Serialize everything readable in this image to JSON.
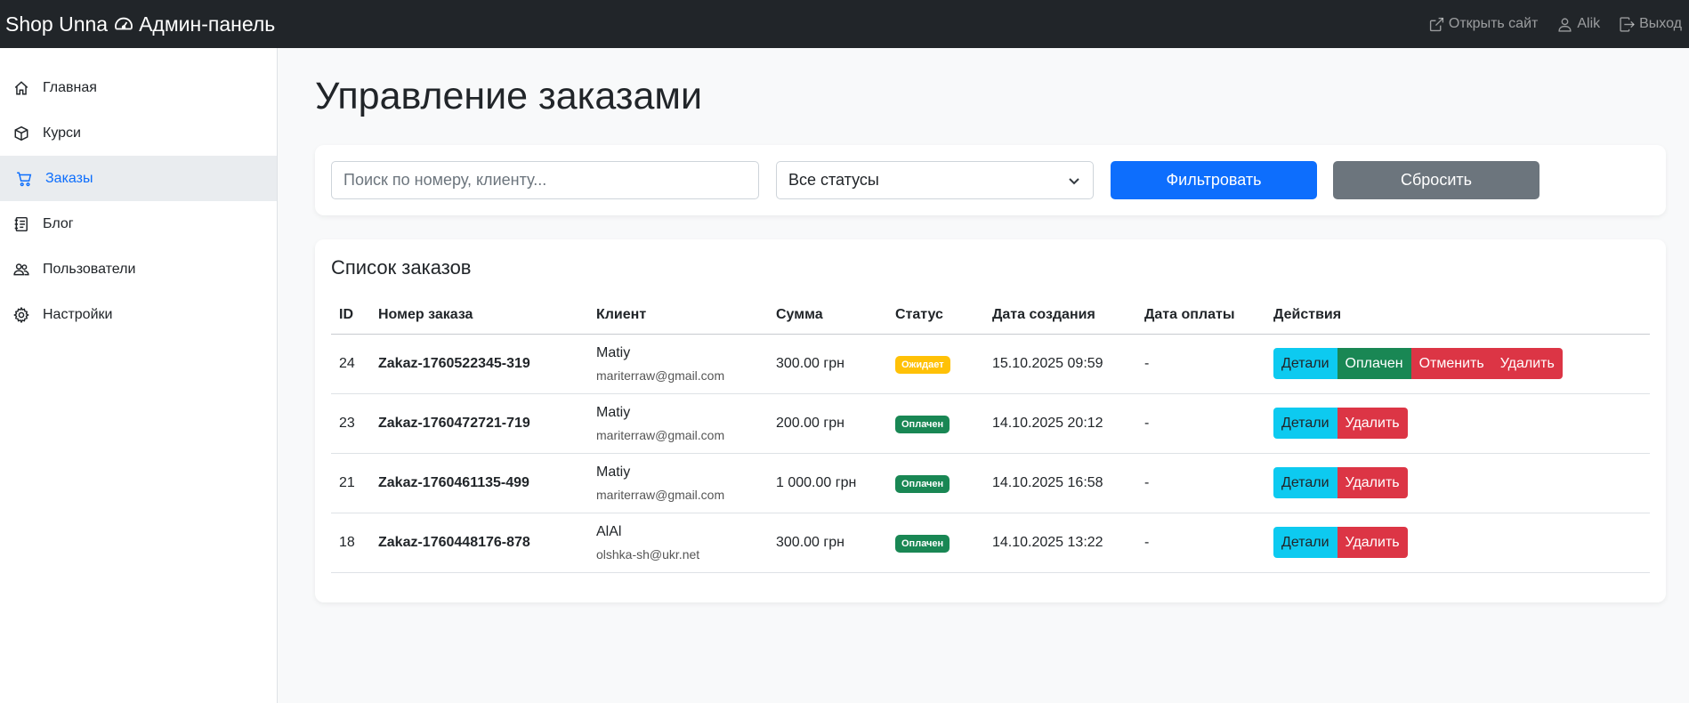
{
  "header": {
    "brand": "Shop Unna",
    "subtitle": "Админ-панель",
    "open_site": "Открыть сайт",
    "user": "Alik",
    "logout": "Выход"
  },
  "sidebar": {
    "items": [
      {
        "label": "Главная",
        "icon": "house-icon"
      },
      {
        "label": "Курси",
        "icon": "box-icon"
      },
      {
        "label": "Заказы",
        "icon": "cart-icon",
        "active": true
      },
      {
        "label": "Блог",
        "icon": "journal-icon"
      },
      {
        "label": "Пользователи",
        "icon": "people-icon"
      },
      {
        "label": "Настройки",
        "icon": "gear-icon"
      }
    ]
  },
  "page": {
    "title": "Управление заказами"
  },
  "filter": {
    "search_placeholder": "Поиск по номеру, клиенту...",
    "search_value": "",
    "status_selected": "Все статусы",
    "filter_button": "Фильтровать",
    "reset_button": "Сбросить"
  },
  "orders": {
    "title": "Список заказов",
    "columns": {
      "id": "ID",
      "number": "Номер заказа",
      "client": "Клиент",
      "amount": "Сумма",
      "status": "Статус",
      "created": "Дата создания",
      "paid": "Дата оплаты",
      "actions": "Действия"
    },
    "rows": [
      {
        "id": "24",
        "number": "Zakaz-1760522345-319",
        "client_name": "Matiy",
        "client_email": "mariterraw@gmail.com",
        "amount": "300.00 грн",
        "status": "Ожидает",
        "status_type": "wait",
        "created": "15.10.2025 09:59",
        "paid": "-",
        "actions": [
          {
            "label": "Детали",
            "type": "info"
          },
          {
            "label": "Оплачен",
            "type": "success"
          },
          {
            "label": "Отменить",
            "type": "danger"
          },
          {
            "label": "Удалить",
            "type": "danger"
          }
        ]
      },
      {
        "id": "23",
        "number": "Zakaz-1760472721-719",
        "client_name": "Matiy",
        "client_email": "mariterraw@gmail.com",
        "amount": "200.00 грн",
        "status": "Оплачен",
        "status_type": "paid",
        "created": "14.10.2025 20:12",
        "paid": "-",
        "actions": [
          {
            "label": "Детали",
            "type": "info"
          },
          {
            "label": "Удалить",
            "type": "danger"
          }
        ]
      },
      {
        "id": "21",
        "number": "Zakaz-1760461135-499",
        "client_name": "Matiy",
        "client_email": "mariterraw@gmail.com",
        "amount": "1 000.00 грн",
        "status": "Оплачен",
        "status_type": "paid",
        "created": "14.10.2025 16:58",
        "paid": "-",
        "actions": [
          {
            "label": "Детали",
            "type": "info"
          },
          {
            "label": "Удалить",
            "type": "danger"
          }
        ]
      },
      {
        "id": "18",
        "number": "Zakaz-1760448176-878",
        "client_name": "AlAl",
        "client_email": "olshka-sh@ukr.net",
        "amount": "300.00 грн",
        "status": "Оплачен",
        "status_type": "paid",
        "created": "14.10.2025 13:22",
        "paid": "-",
        "actions": [
          {
            "label": "Детали",
            "type": "info"
          },
          {
            "label": "Удалить",
            "type": "danger"
          }
        ]
      }
    ]
  },
  "colors": {
    "primary": "#0d6efd",
    "secondary": "#6c757d",
    "info": "#0dcaf0",
    "success": "#198754",
    "danger": "#dc3545",
    "warning": "#ffc107",
    "dark": "#212529"
  }
}
